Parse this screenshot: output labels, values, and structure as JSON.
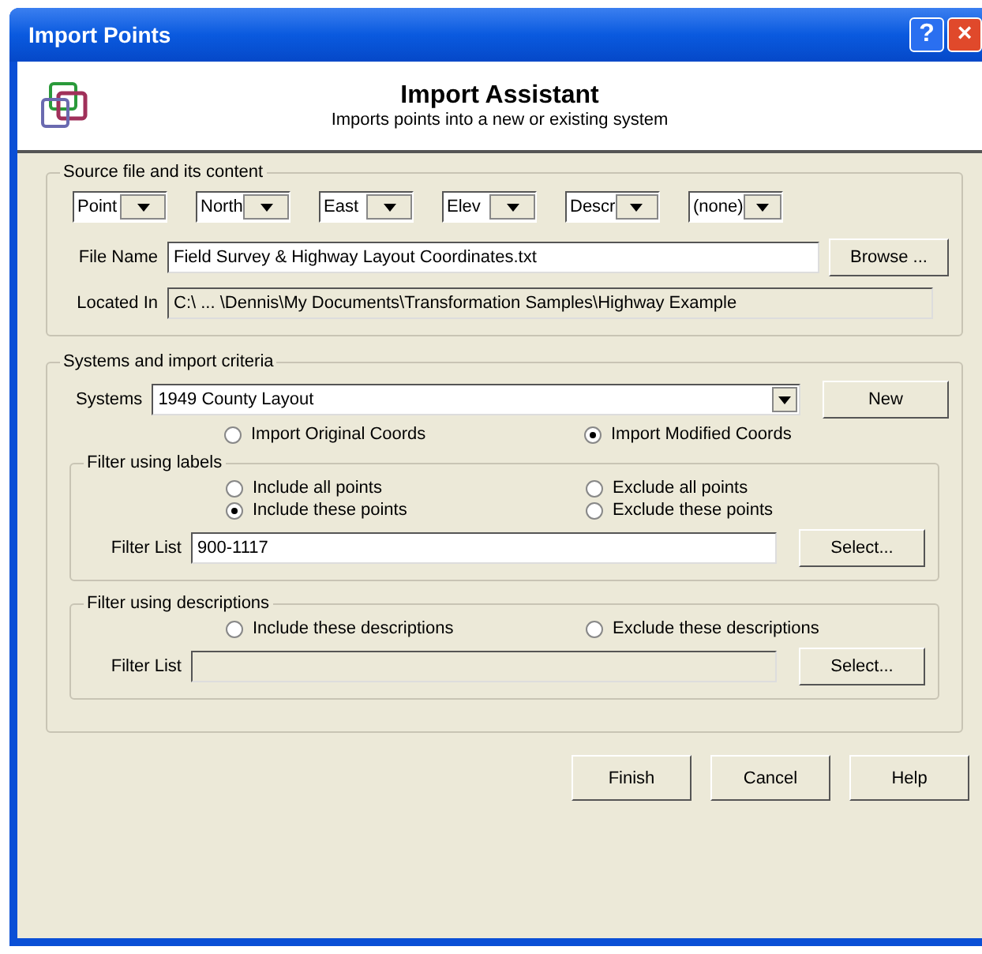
{
  "window": {
    "title": "Import Points",
    "buttons": [
      "?",
      "×"
    ]
  },
  "header": {
    "title": "Import Assistant",
    "subtitle": "Imports points into a new or existing system"
  },
  "source": {
    "legend": "Source file and its content",
    "columns": [
      {
        "value": "Point"
      },
      {
        "value": "North"
      },
      {
        "value": "East"
      },
      {
        "value": "Elev"
      },
      {
        "value": "Descr"
      },
      {
        "value": "(none)"
      }
    ],
    "file_name": {
      "label": "File Name",
      "value": "Field Survey & Highway Layout Coordinates.txt",
      "button": "Browse ..."
    },
    "located_in": {
      "label": "Located In",
      "value": "C:\\ ... \\Dennis\\My Documents\\Transformation Samples\\Highway Example"
    }
  },
  "systems": {
    "legend": "Systems and import criteria",
    "label": "Systems",
    "value": "1949 County Layout",
    "button": "New",
    "coord_options": [
      {
        "label": "Import Original Coords",
        "selected": false
      },
      {
        "label": "Import Modified Coords",
        "selected": true
      }
    ],
    "filter_labels": {
      "legend": "Filter using labels",
      "options": [
        {
          "label": "Include all points",
          "selected": false
        },
        {
          "label": "Exclude all points",
          "selected": false
        },
        {
          "label": "Include these points",
          "selected": true
        },
        {
          "label": "Exclude these points",
          "selected": false
        }
      ],
      "filter_list": {
        "label": "Filter List",
        "value": "900-1117",
        "disabled": false
      },
      "button": "Select..."
    },
    "filter_descriptions": {
      "legend": "Filter using descriptions",
      "options": [
        {
          "label": "Include these descriptions",
          "selected": false
        },
        {
          "label": "Exclude these descriptions",
          "selected": false
        }
      ],
      "filter_list": {
        "label": "Filter List",
        "disabled": true
      },
      "button": "Select..."
    }
  },
  "buttons": [
    "Finish",
    "Cancel",
    "Help"
  ]
}
